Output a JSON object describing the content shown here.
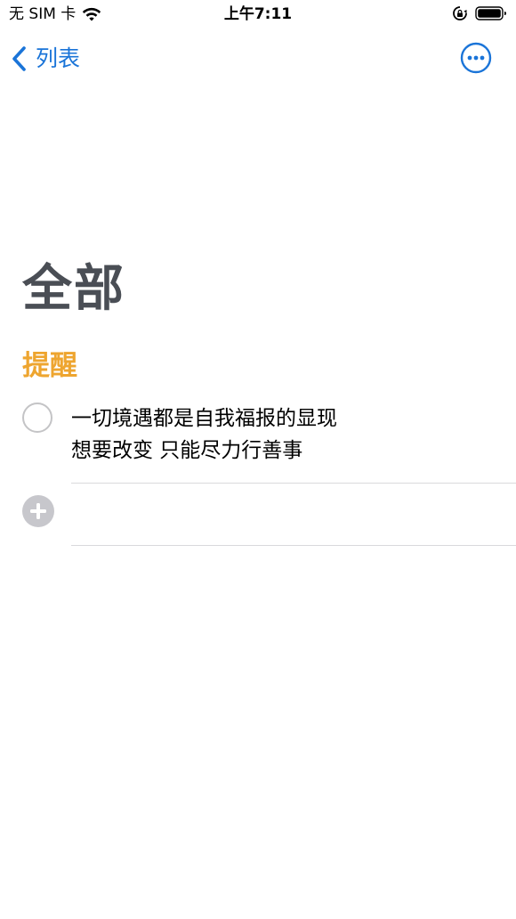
{
  "status_bar": {
    "carrier": "无 SIM 卡",
    "time": "上午7:11"
  },
  "nav": {
    "back_label": "列表",
    "more_icon": "ellipsis-circle-icon"
  },
  "title": "全部",
  "section": {
    "header": "提醒"
  },
  "reminders": [
    {
      "line1": "一切境遇都是自我福报的显现",
      "line2": "想要改变 只能尽力行善事"
    }
  ],
  "colors": {
    "accent_blue": "#1a74d8",
    "title_gray": "#4a4e55",
    "section_orange": "#eea52f",
    "circle_gray": "#c4c4c6",
    "divider_gray": "#d9d9dc"
  }
}
